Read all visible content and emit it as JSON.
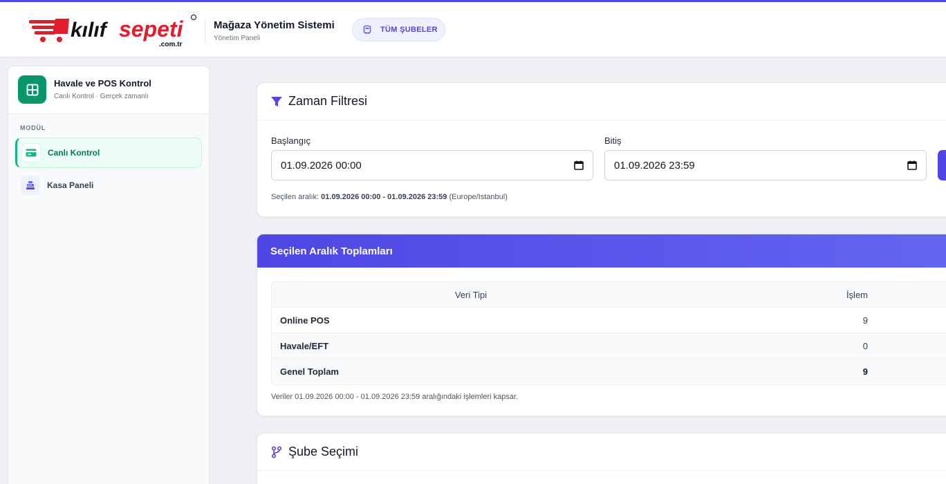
{
  "header": {
    "logo_text": "kılıf sepeti .com.tr",
    "app_title": "Mağaza Yönetim Sistemi",
    "app_subtitle": "Yönetim Paneli",
    "branch_button": "TÜM ŞUBELER"
  },
  "sidebar": {
    "title": "Havale ve POS Kontrol",
    "subtitle": "Canlı Kontrol · Gerçek zamanlı",
    "section_label": "MODÜL",
    "items": [
      {
        "label": "Canlı Kontrol",
        "icon": "card-icon",
        "active": true
      },
      {
        "label": "Kasa Paneli",
        "icon": "cash-register-icon",
        "active": false
      }
    ]
  },
  "time_filter": {
    "title": "Zaman Filtresi",
    "start_label": "Başlangıç",
    "start_value": "01.09.2026 00:00",
    "end_label": "Bitiş",
    "end_value": "01.09.2026 23:59",
    "range_prefix": "Seçilen aralık:",
    "range_value": "01.09.2026 00:00 - 01.09.2026 23:59",
    "timezone": "(Europe/Istanbul)"
  },
  "totals": {
    "title": "Seçilen Aralık Toplamları",
    "columns": [
      "Veri Tipi",
      "İşlem"
    ],
    "rows": [
      {
        "type": "Online POS",
        "count": "9"
      },
      {
        "type": "Havale/EFT",
        "count": "0"
      },
      {
        "type": "Genel Toplam",
        "count": "9"
      }
    ],
    "note": "Veriler 01.09.2026 00:00 - 01.09.2026 23:59 aralığındaki işlemleri kapsar."
  },
  "branch_select": {
    "title": "Şube Seçimi"
  },
  "colors": {
    "accent": "#4f46e5",
    "success": "#059669",
    "logo_red": "#e11d2e"
  }
}
